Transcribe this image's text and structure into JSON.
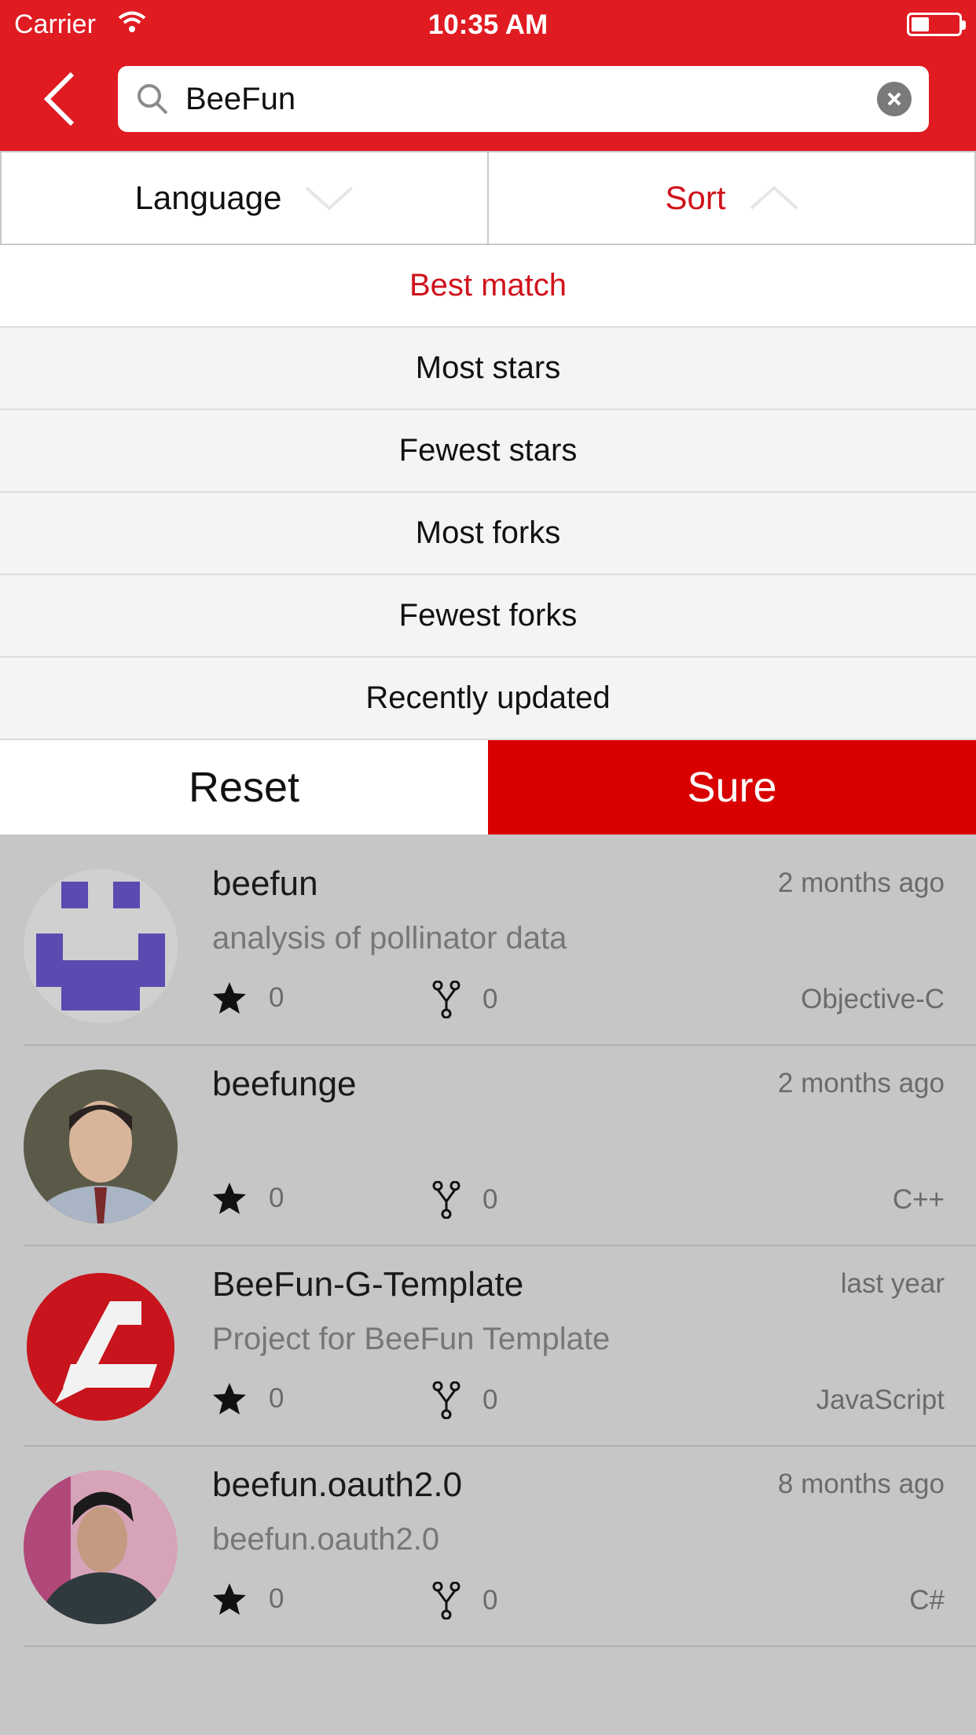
{
  "status": {
    "carrier": "Carrier",
    "time": "10:35 AM"
  },
  "search": {
    "query": "BeeFun"
  },
  "filters": [
    {
      "label": "Language",
      "active": false
    },
    {
      "label": "Sort",
      "active": true
    }
  ],
  "sort_options": [
    {
      "label": "Best match",
      "selected": true
    },
    {
      "label": "Most stars",
      "selected": false
    },
    {
      "label": "Fewest stars",
      "selected": false
    },
    {
      "label": "Most forks",
      "selected": false
    },
    {
      "label": "Fewest forks",
      "selected": false
    },
    {
      "label": "Recently updated",
      "selected": false
    }
  ],
  "actions": {
    "reset": "Reset",
    "sure": "Sure"
  },
  "results": [
    {
      "name": "beefun",
      "date": "2 months ago",
      "desc": "analysis of pollinator data",
      "stars": "0",
      "forks": "0",
      "language": "Objective-C",
      "avatar": "identicon"
    },
    {
      "name": "beefunge",
      "date": "2 months ago",
      "desc": "",
      "stars": "0",
      "forks": "0",
      "language": "C++",
      "avatar": "person-photo"
    },
    {
      "name": "BeeFun-G-Template",
      "date": "last year",
      "desc": "Project for BeeFun Template",
      "stars": "0",
      "forks": "0",
      "language": "JavaScript",
      "avatar": "red-logo"
    },
    {
      "name": "beefun.oauth2.0",
      "date": "8 months ago",
      "desc": "beefun.oauth2.0",
      "stars": "0",
      "forks": "0",
      "language": "C#",
      "avatar": "person-photo-2"
    }
  ],
  "colors": {
    "brand": "#e01b22",
    "selected": "#d0121b",
    "sure": "#d90000"
  }
}
